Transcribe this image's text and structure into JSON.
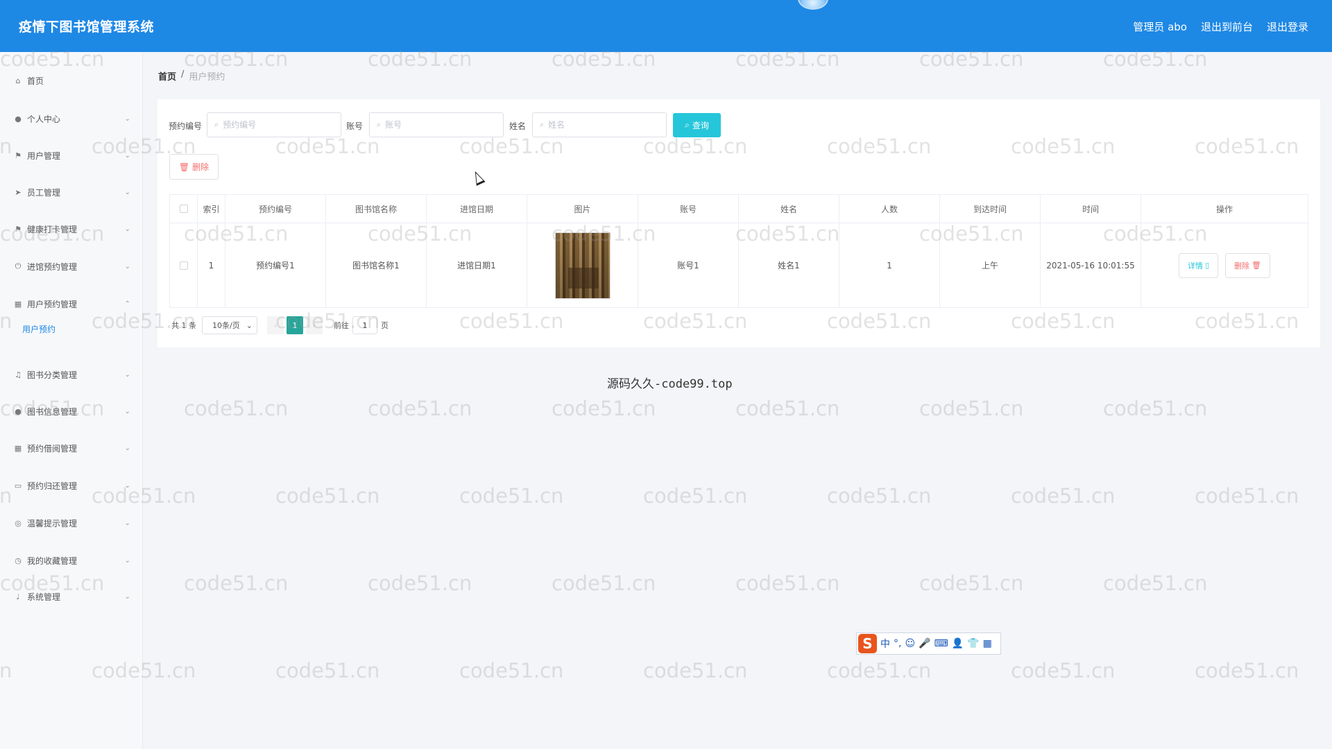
{
  "header": {
    "title": "疫情下图书馆管理系统",
    "admin_label": "管理员 abo",
    "to_front_label": "退出到前台",
    "logout_label": "退出登录"
  },
  "sidebar": {
    "items": [
      {
        "label": "首页",
        "icon": "home-icon"
      },
      {
        "label": "个人中心",
        "icon": "user-icon"
      },
      {
        "label": "用户管理",
        "icon": "flag-icon"
      },
      {
        "label": "员工管理",
        "icon": "send-icon"
      },
      {
        "label": "健康打卡管理",
        "icon": "flag-icon"
      },
      {
        "label": "进馆预约管理",
        "icon": "power-icon"
      },
      {
        "label": "用户预约管理",
        "icon": "grid-icon"
      },
      {
        "label": "图书分类管理",
        "icon": "bell-icon"
      },
      {
        "label": "图书信息管理",
        "icon": "user-icon"
      },
      {
        "label": "预约借阅管理",
        "icon": "grid-icon"
      },
      {
        "label": "预约归还管理",
        "icon": "chat-icon"
      },
      {
        "label": "温馨提示管理",
        "icon": "globe-icon"
      },
      {
        "label": "我的收藏管理",
        "icon": "clock-icon"
      },
      {
        "label": "系统管理",
        "icon": "mic-icon"
      }
    ],
    "active_sub": "用户预约"
  },
  "breadcrumb": {
    "home": "首页",
    "sep": "/",
    "current": "用户预约"
  },
  "search": {
    "fields": [
      {
        "label": "预约编号",
        "placeholder": "预约编号"
      },
      {
        "label": "账号",
        "placeholder": "账号"
      },
      {
        "label": "姓名",
        "placeholder": "姓名"
      }
    ],
    "query_label": "查询"
  },
  "actions": {
    "delete_label": "删除"
  },
  "table": {
    "columns": [
      "索引",
      "预约编号",
      "图书馆名称",
      "进馆日期",
      "图片",
      "账号",
      "姓名",
      "人数",
      "到达时间",
      "时间",
      "操作"
    ],
    "rows": [
      {
        "index": "1",
        "reservation_no": "预约编号1",
        "library_name": "图书馆名称1",
        "entry_date": "进馆日期1",
        "account": "账号1",
        "name": "姓名1",
        "count": "1",
        "arrival": "上午",
        "time": "2021-05-16 10:01:55",
        "detail_label": "详情",
        "delete_label": "删除"
      }
    ]
  },
  "pagination": {
    "total": "共 1 条",
    "page_size": "10条/页",
    "current_page": "1",
    "goto_label": "前往",
    "goto_value": "1",
    "page_unit": "页"
  },
  "footer": {
    "text": "源码久久-code99.top"
  },
  "ime": {
    "logo": "S",
    "items": [
      "中",
      "°,",
      "☺",
      "🎤",
      "⌨",
      "👤",
      "👕",
      "▦"
    ]
  },
  "watermark": "code51.cn"
}
